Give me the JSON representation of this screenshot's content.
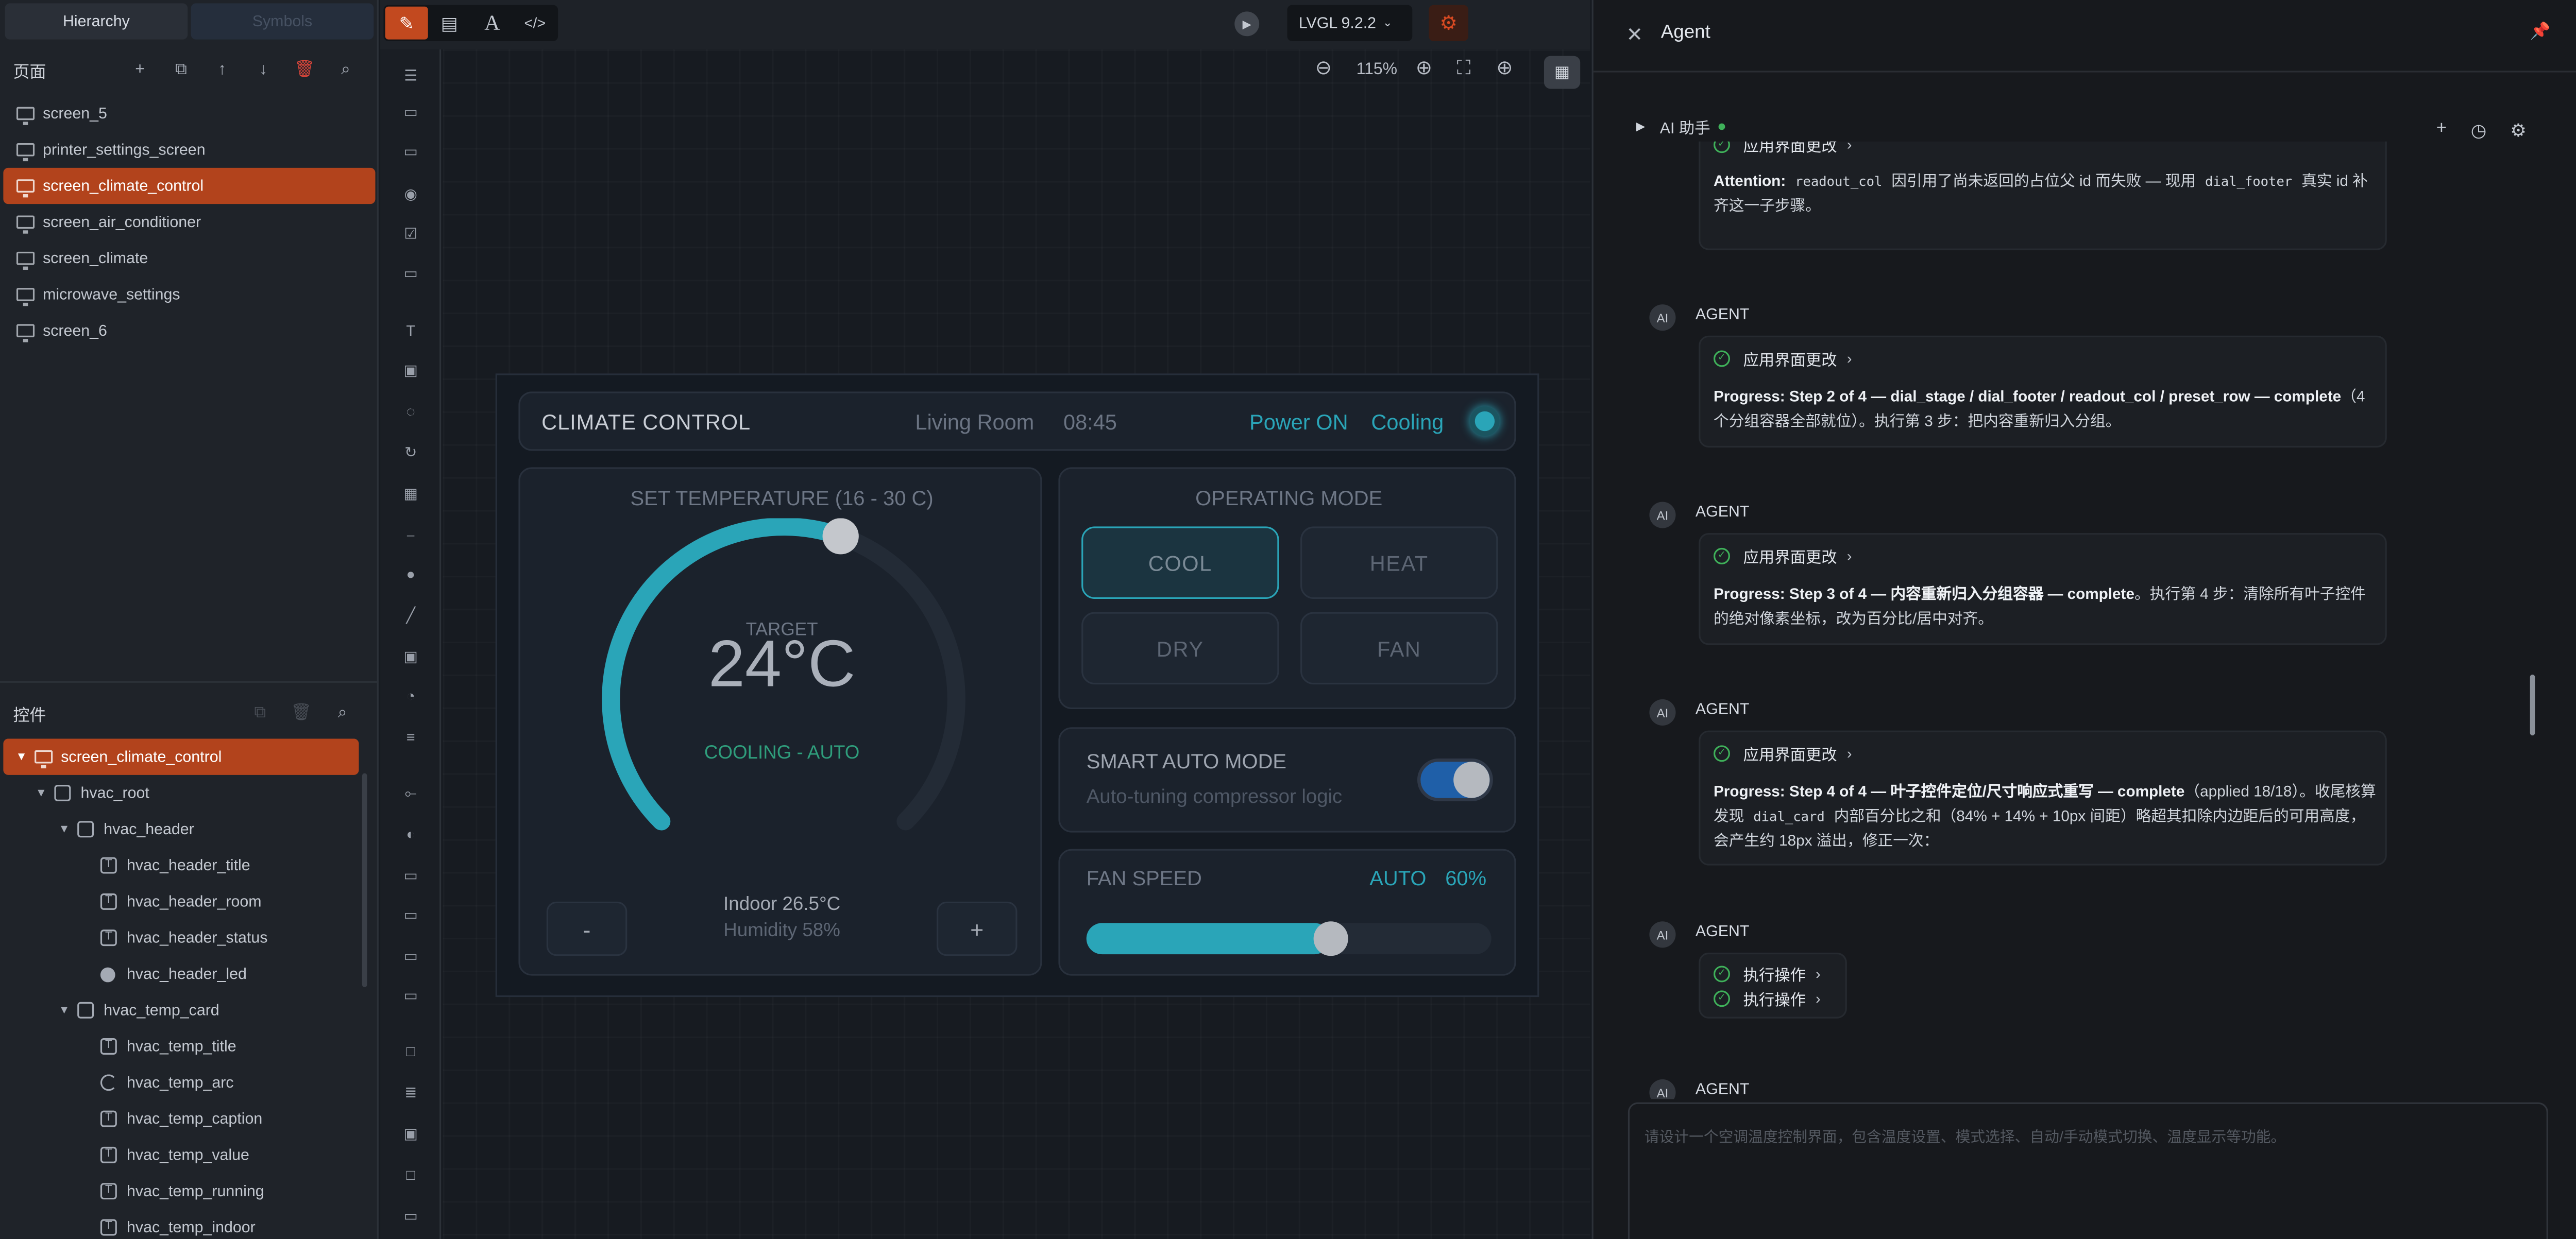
{
  "left_panel": {
    "tabs": [
      "Hierarchy",
      "Symbols"
    ],
    "pages_title": "页面",
    "screens": [
      "screen_5",
      "printer_settings_screen",
      "screen_climate_control",
      "screen_air_conditioner",
      "screen_climate",
      "microwave_settings",
      "screen_6"
    ],
    "selected_screen": "screen_climate_control",
    "widgets_title": "控件",
    "tree": [
      {
        "label": "screen_climate_control",
        "icon": "monitor-icon",
        "depth": 0,
        "caret": "▼"
      },
      {
        "label": "hvac_root",
        "icon": "container-icon",
        "depth": 1,
        "caret": "▼"
      },
      {
        "label": "hvac_header",
        "icon": "container-icon",
        "depth": 2,
        "caret": "▼"
      },
      {
        "label": "hvac_header_title",
        "icon": "text-icon",
        "depth": 3,
        "caret": ""
      },
      {
        "label": "hvac_header_room",
        "icon": "text-icon",
        "depth": 3,
        "caret": ""
      },
      {
        "label": "hvac_header_status",
        "icon": "text-icon",
        "depth": 3,
        "caret": ""
      },
      {
        "label": "hvac_header_led",
        "icon": "led-icon",
        "depth": 3,
        "caret": ""
      },
      {
        "label": "hvac_temp_card",
        "icon": "container-icon",
        "depth": 2,
        "caret": "▼"
      },
      {
        "label": "hvac_temp_title",
        "icon": "text-icon",
        "depth": 3,
        "caret": ""
      },
      {
        "label": "hvac_temp_arc",
        "icon": "arc-icon",
        "depth": 3,
        "caret": ""
      },
      {
        "label": "hvac_temp_caption",
        "icon": "text-icon",
        "depth": 3,
        "caret": ""
      },
      {
        "label": "hvac_temp_value",
        "icon": "text-icon",
        "depth": 3,
        "caret": ""
      },
      {
        "label": "hvac_temp_running",
        "icon": "text-icon",
        "depth": 3,
        "caret": ""
      },
      {
        "label": "hvac_temp_indoor",
        "icon": "text-icon",
        "depth": 3,
        "caret": ""
      }
    ]
  },
  "toolbar": {
    "version": "LVGL 9.2.2",
    "zoom": "115%",
    "mode_icons": [
      "edit-icon",
      "pages-icon",
      "text-tool-icon",
      "code-icon"
    ]
  },
  "device": {
    "header": {
      "title": "CLIMATE CONTROL",
      "room": "Living Room",
      "time": "08:45",
      "power": "Power ON",
      "status": "Cooling"
    },
    "temp": {
      "title": "SET TEMPERATURE (16 - 30 C)",
      "caption": "TARGET",
      "value": "24°C",
      "running": "COOLING - AUTO",
      "indoor": "Indoor 26.5°C",
      "humidity": "Humidity 58%",
      "minus": "-",
      "plus": "+",
      "min": 16,
      "max": 30,
      "setpoint": 24
    },
    "mode": {
      "title": "OPERATING MODE",
      "options": [
        "COOL",
        "HEAT",
        "DRY",
        "FAN"
      ],
      "selected": "COOL"
    },
    "smart": {
      "title": "SMART AUTO MODE",
      "subtitle": "Auto-tuning compressor logic",
      "enabled": true
    },
    "fan": {
      "title": "FAN SPEED",
      "auto": "AUTO",
      "value_text": "60%",
      "level": 0.6
    },
    "colors": {
      "accent": "#2aa5b8",
      "running": "#2f9e7c",
      "toggle": "#1f5fa8"
    }
  },
  "agent_panel": {
    "title": "Agent",
    "assistant": "AI 助手",
    "messages": [
      {
        "agent": "AGENT",
        "action": "应用界面更改",
        "lead": "Progress: Step 2 of 4 — dial_stage / dial_footer / readout_col / preset_row — complete",
        "rest": "（4 个分组容器全部就位）。执行第 3 步：把内容重新归入分组。"
      },
      {
        "agent": "AGENT",
        "action": "应用界面更改",
        "lead": "Progress: Step 3 of 4 — 内容重新归入分组容器 — complete",
        "rest": "。执行第 4 步：清除所有叶子控件的绝对像素坐标，改为百分比/居中对齐。"
      },
      {
        "agent": "AGENT",
        "action": "应用界面更改",
        "lead": "Progress: Step 4 of 4 — 叶子控件定位/尺寸响应式重写 — complete",
        "rest_a": "（applied 18/18）。收尾核算发现 ",
        "code": "dial_card",
        "rest_b": " 内部百分比之和（84% + 14% + 10px 间距）略超其扣除内边距后的可用高度，会产生约 18px 溢出，修正一次："
      },
      {
        "agent": "AGENT",
        "actions": [
          "执行操作",
          "执行操作"
        ]
      },
      {
        "agent": "AGENT"
      }
    ],
    "partial": {
      "action": "应用界面更改",
      "attention_label": "Attention:",
      "code1": "readout_col",
      "text1": "因引用了尚未返回的占位父 id 而失败 — 现用",
      "code2": "dial_footer",
      "text2": "真实 id 补齐这一子步骤。"
    },
    "input_placeholder": "请设计一个空调温度控制界面，包含温度设置、模式选择、自动/手动模式切换、温度显示等功能。"
  }
}
